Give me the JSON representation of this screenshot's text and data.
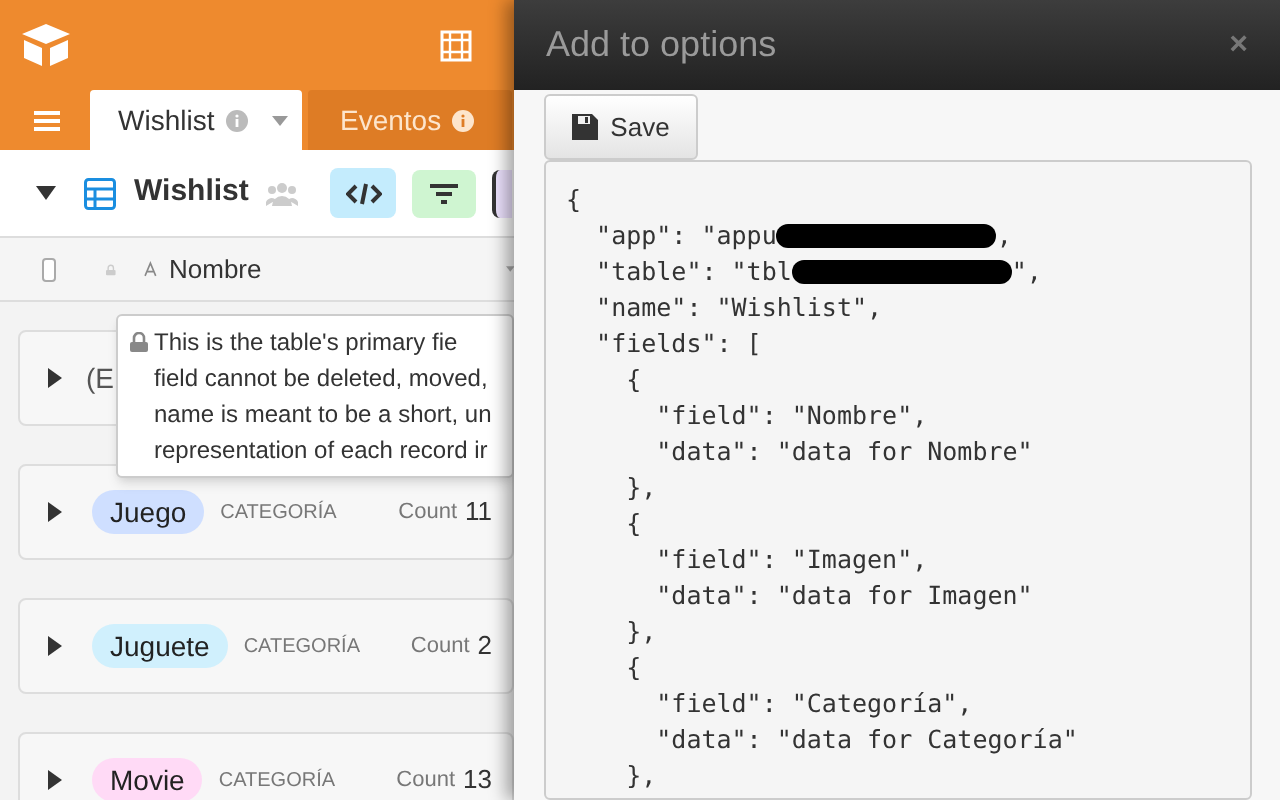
{
  "app": {
    "tabs": [
      {
        "label": "Wishlist",
        "selected": true
      },
      {
        "label": "Eventos",
        "selected": false
      }
    ],
    "view": {
      "title": "Wishlist"
    },
    "select_all": {
      "checked": false
    },
    "column_header": {
      "label": "Nombre"
    },
    "tooltip": {
      "lines": [
        "This is the table's primary fie",
        "field cannot be deleted, moved,",
        "name is meant to be a short, un",
        "representation of each record ir"
      ]
    },
    "groups": [
      {
        "kind": "partial",
        "label": "(E"
      },
      {
        "kind": "full",
        "label": "Juego",
        "color": "#cfdfff",
        "field": "CATEGORÍA",
        "count_label": "Count",
        "count": "11"
      },
      {
        "kind": "full",
        "label": "Juguete",
        "color": "#d0f0fd",
        "field": "CATEGORÍA",
        "count_label": "Count",
        "count": "2"
      },
      {
        "kind": "full",
        "label": "Movie",
        "color": "#ffdaf6",
        "field": "CATEGORÍA",
        "count_label": "Count",
        "count": "13"
      }
    ]
  },
  "dialog": {
    "title": "Add to options",
    "close": "×",
    "save_button": "Save",
    "code_lines": [
      {
        "kind": "plain",
        "text": "{"
      },
      {
        "kind": "redacted",
        "before": "  \"app\": \"appu",
        "after": ","
      },
      {
        "kind": "redacted",
        "before": "  \"table\": \"tbl",
        "after": "\","
      },
      {
        "kind": "plain",
        "text": "  \"name\": \"Wishlist\","
      },
      {
        "kind": "plain",
        "text": "  \"fields\": ["
      },
      {
        "kind": "plain",
        "text": "    {"
      },
      {
        "kind": "plain",
        "text": "      \"field\": \"Nombre\","
      },
      {
        "kind": "plain",
        "text": "      \"data\": \"data for Nombre\""
      },
      {
        "kind": "plain",
        "text": "    },"
      },
      {
        "kind": "plain",
        "text": "    {"
      },
      {
        "kind": "plain",
        "text": "      \"field\": \"Imagen\","
      },
      {
        "kind": "plain",
        "text": "      \"data\": \"data for Imagen\""
      },
      {
        "kind": "plain",
        "text": "    },"
      },
      {
        "kind": "plain",
        "text": "    {"
      },
      {
        "kind": "plain",
        "text": "      \"field\": \"Categoría\","
      },
      {
        "kind": "plain",
        "text": "      \"data\": \"data for Categoría\""
      },
      {
        "kind": "plain",
        "text": "    },"
      }
    ]
  }
}
